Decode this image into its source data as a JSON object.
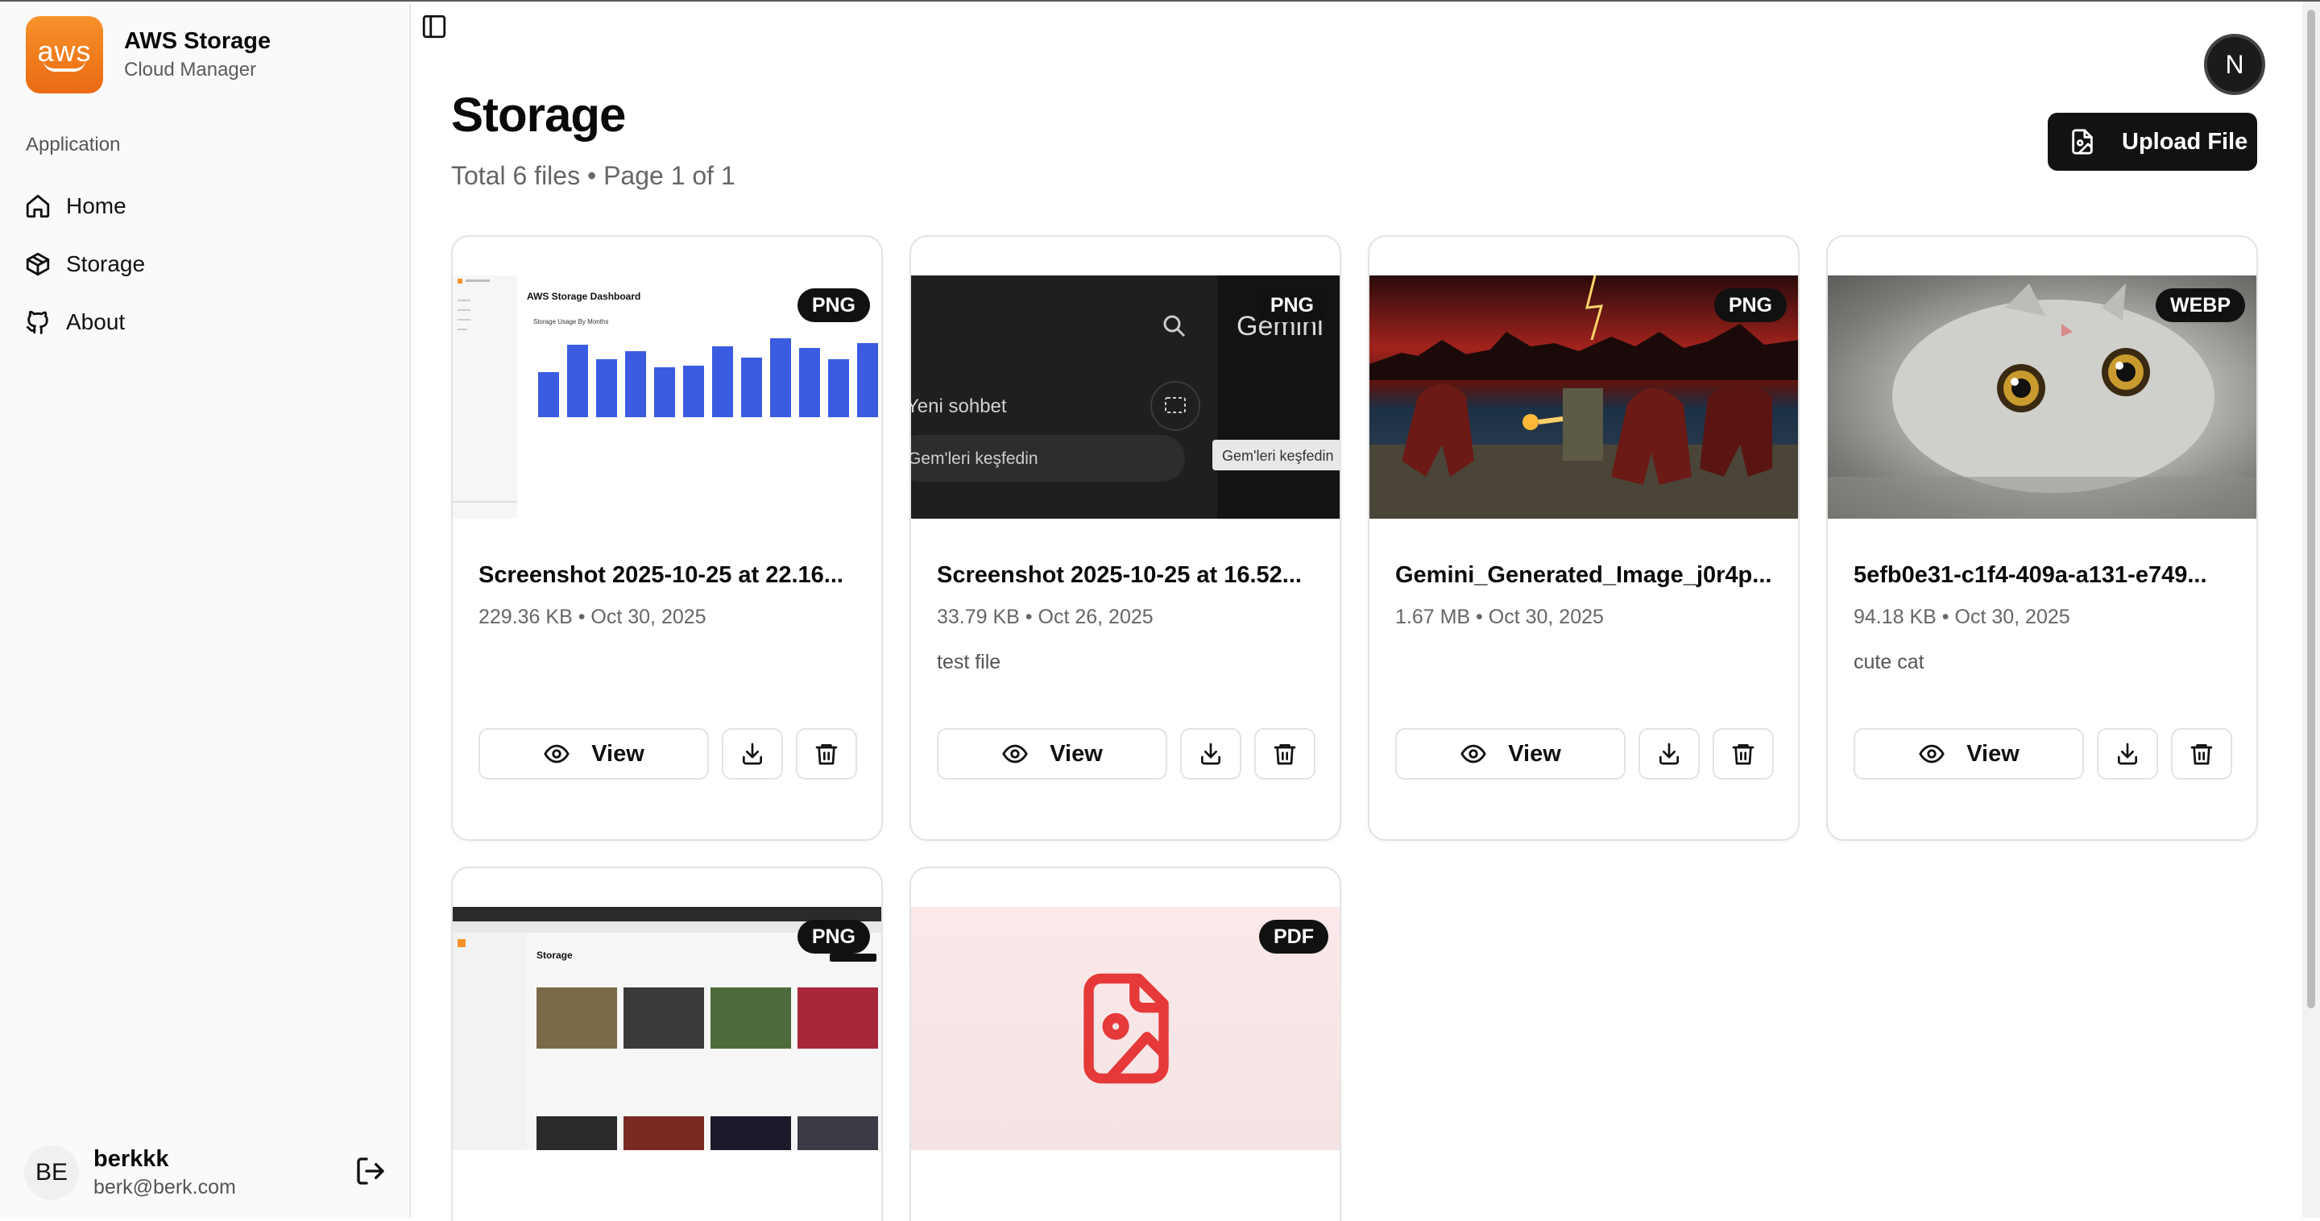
{
  "brand": {
    "title": "AWS Storage",
    "subtitle": "Cloud Manager",
    "logo_text": "aws"
  },
  "sidebar": {
    "group_label": "Application",
    "items": [
      {
        "label": "Home",
        "icon": "home-icon"
      },
      {
        "label": "Storage",
        "icon": "box-icon"
      },
      {
        "label": "About",
        "icon": "github-icon"
      }
    ]
  },
  "user": {
    "initials": "BE",
    "name": "berkkk",
    "email": "berk@berk.com"
  },
  "top_avatar": "N",
  "page": {
    "title": "Storage",
    "total": "Total 6 files",
    "separator": "•",
    "page_info": "Page 1 of 1"
  },
  "upload_label": "Upload File",
  "view_label": "View",
  "files": [
    {
      "name": "Screenshot 2025-10-25 at 22.16...",
      "size": "229.36 KB",
      "date": "Oct 30, 2025",
      "type": "PNG",
      "description": ""
    },
    {
      "name": "Screenshot 2025-10-25 at 16.52...",
      "size": "33.79 KB",
      "date": "Oct 26, 2025",
      "type": "PNG",
      "description": "test file"
    },
    {
      "name": "Gemini_Generated_Image_j0r4p...",
      "size": "1.67 MB",
      "date": "Oct 30, 2025",
      "type": "PNG",
      "description": ""
    },
    {
      "name": "5efb0e31-c1f4-409a-a131-e749...",
      "size": "94.18 KB",
      "date": "Oct 30, 2025",
      "type": "WEBP",
      "description": "cute cat"
    },
    {
      "name": "",
      "size": "",
      "date": "",
      "type": "PNG",
      "description": ""
    },
    {
      "name": "",
      "size": "",
      "date": "",
      "type": "PDF",
      "description": ""
    }
  ],
  "meta": {
    "file1": "229.36 KB • Oct 30, 2025",
    "file2": "33.79 KB • Oct 26, 2025",
    "file3": "1.67 MB • Oct 30, 2025",
    "file4": "94.18 KB • Oct 30, 2025"
  },
  "thumb_text": {
    "dash_title": "AWS Storage Dashboard",
    "dash_sub": "Storage Usage By Months",
    "gemini_brand": "Gemini",
    "gemini_new": "Yeni sohbet",
    "gemini_explore": "Gem'leri keşfedin",
    "gemini_tooltip": "Gem'leri keşfedin",
    "grid_title": "Storage"
  },
  "colors": {
    "accent": "#121212",
    "aws_orange": "#f7922b",
    "pdf_red": "#e5393a",
    "bar_blue": "#3b5be0"
  }
}
